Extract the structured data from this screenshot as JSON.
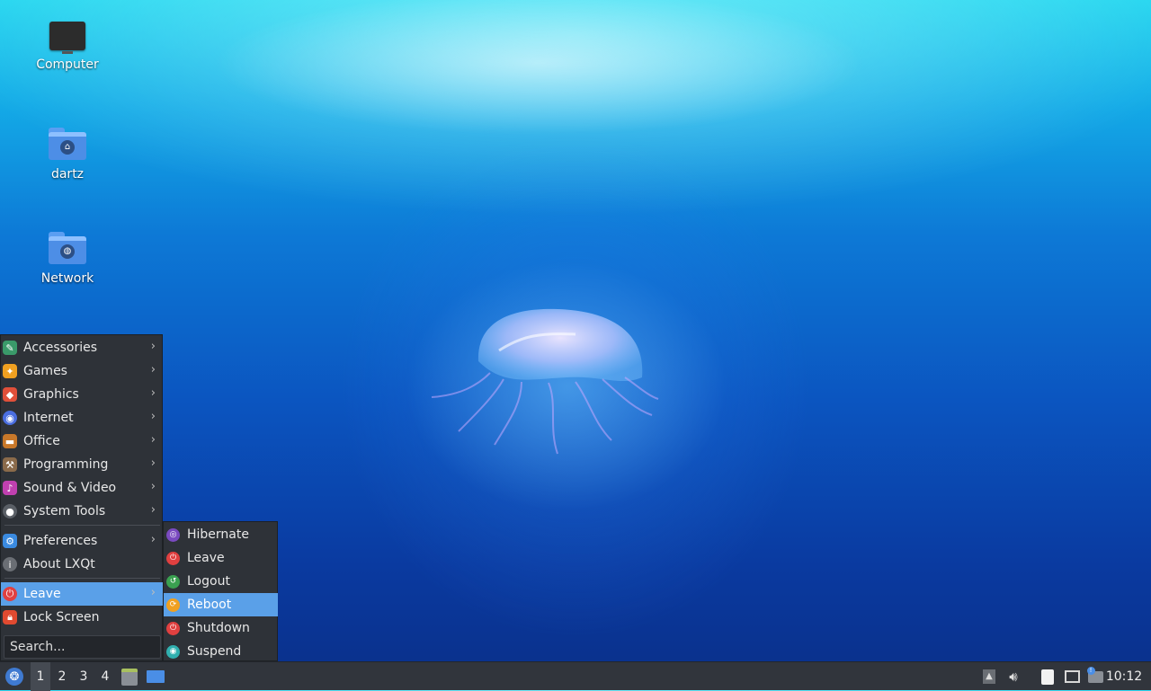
{
  "desktop": {
    "icons": [
      {
        "label": "Computer",
        "icon": "computer-icon"
      },
      {
        "label": "dartz",
        "icon": "home-folder-icon"
      },
      {
        "label": "Network",
        "icon": "network-folder-icon"
      }
    ]
  },
  "menu": {
    "items": [
      {
        "label": "Accessories",
        "icon": "accessories-icon",
        "color": "#3a9a6a"
      },
      {
        "label": "Games",
        "icon": "games-icon",
        "color": "#f0a020"
      },
      {
        "label": "Graphics",
        "icon": "graphics-icon",
        "color": "#e0503a"
      },
      {
        "label": "Internet",
        "icon": "internet-icon",
        "color": "#4a6ee0"
      },
      {
        "label": "Office",
        "icon": "office-icon",
        "color": "#c8782a"
      },
      {
        "label": "Programming",
        "icon": "programming-icon",
        "color": "#8a6a4a"
      },
      {
        "label": "Sound & Video",
        "icon": "sound-video-icon",
        "color": "#c040b0"
      },
      {
        "label": "System Tools",
        "icon": "system-tools-icon",
        "color": "#5a5f66"
      },
      {
        "label": "Preferences",
        "icon": "preferences-icon",
        "color": "#3a8ae0"
      },
      {
        "label": "About LXQt",
        "icon": "about-icon",
        "color": "#6a6e74"
      },
      {
        "label": "Leave",
        "icon": "leave-icon",
        "color": "#e04040"
      },
      {
        "label": "Lock Screen",
        "icon": "lock-icon",
        "color": "#e04a30"
      }
    ],
    "search_placeholder": "Search..."
  },
  "leave_submenu": {
    "items": [
      {
        "label": "Hibernate",
        "icon": "hibernate-icon",
        "color": "#7a4ac0"
      },
      {
        "label": "Leave",
        "icon": "leave-power-icon",
        "color": "#e04040"
      },
      {
        "label": "Logout",
        "icon": "logout-icon",
        "color": "#3aa050"
      },
      {
        "label": "Reboot",
        "icon": "reboot-icon",
        "color": "#f0a020"
      },
      {
        "label": "Shutdown",
        "icon": "shutdown-icon",
        "color": "#e04040"
      },
      {
        "label": "Suspend",
        "icon": "suspend-icon",
        "color": "#30b0b0"
      }
    ]
  },
  "taskbar": {
    "desktops": [
      "1",
      "2",
      "3",
      "4"
    ],
    "clock": "10:12"
  }
}
